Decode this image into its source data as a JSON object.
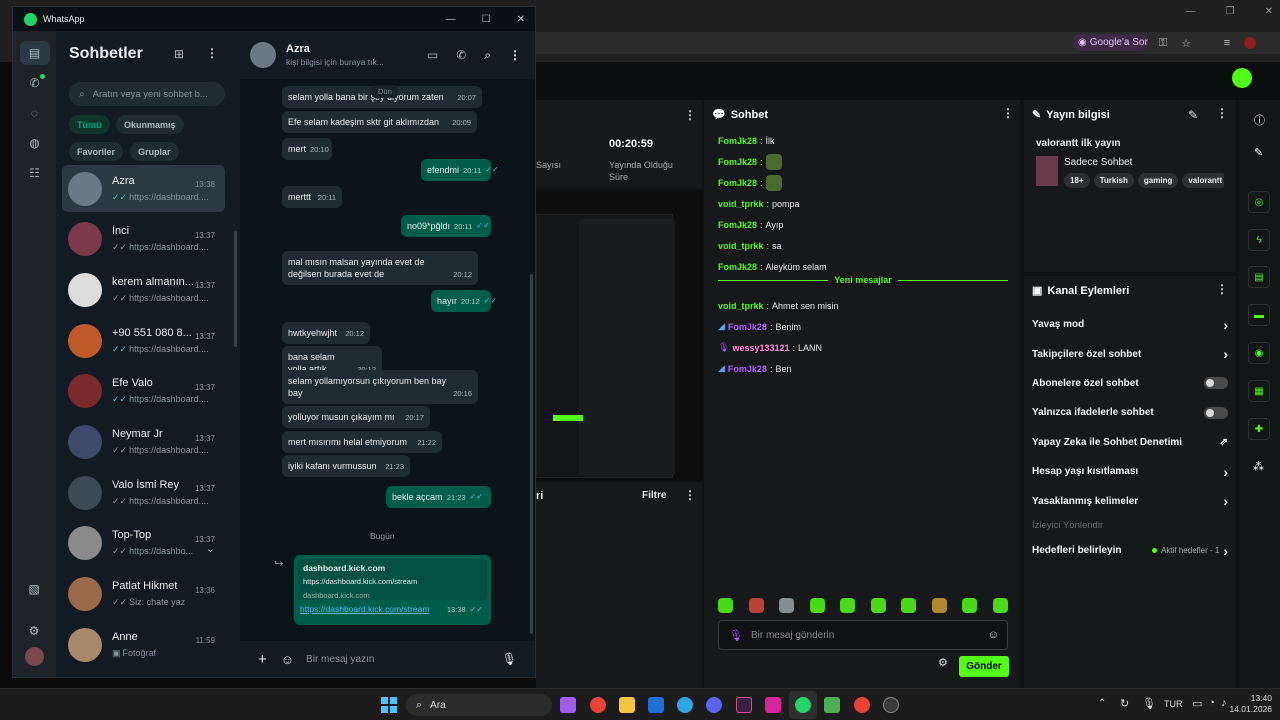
{
  "browser": {
    "google_sor": "Google'a Sor",
    "icons": [
      "lens-icon",
      "key-icon",
      "star-icon",
      "menu-icon",
      "profile-icon"
    ]
  },
  "whatsapp": {
    "title": "WhatsApp",
    "sidebar_title": "Sohbetler",
    "search_placeholder": "Aratın veya yeni sohbet b...",
    "filters": [
      "Tümü",
      "Okunmamış",
      "Favoriler",
      "Gruplar"
    ],
    "chats": [
      {
        "name": "Azra",
        "time": "13:38",
        "preview": "https://dashboard....",
        "tick": "blue",
        "color": "#6b7a86"
      },
      {
        "name": "İnci",
        "time": "13:37",
        "preview": "https://dashboard....",
        "tick": "grey",
        "color": "#7a3a4a"
      },
      {
        "name": "kerem almanın...",
        "time": "13:37",
        "preview": "https://dashboard....",
        "tick": "grey",
        "color": "#dcdcdc"
      },
      {
        "name": "+90 551 080 8...",
        "time": "13:37",
        "preview": "https://dashboard....",
        "tick": "blue",
        "color": "#c05a2a"
      },
      {
        "name": "Efe Valo",
        "time": "13:37",
        "preview": "https://dashboard....",
        "tick": "blue",
        "color": "#7a2a2a"
      },
      {
        "name": "Neymar Jr",
        "time": "13:37",
        "preview": "https://dashboard....",
        "tick": "grey",
        "color": "#3d4a6b"
      },
      {
        "name": "Valo İsmi Rey",
        "time": "13:37",
        "preview": "https://dashboard....",
        "tick": "grey",
        "color": "#3b4a54"
      },
      {
        "name": "Top-Top",
        "time": "13:37",
        "preview": "https://dashbo...",
        "tick": "grey",
        "color": "#8a8a8a"
      },
      {
        "name": "Patlat Hikmet",
        "time": "13:36",
        "preview": "Siz: chate yaz",
        "tick": "grey",
        "color": "#9a6a4a"
      },
      {
        "name": "Anne",
        "time": "11:59",
        "preview": "Fotoğraf",
        "tick": "none",
        "color": "#a88a6a"
      }
    ],
    "conversation": {
      "name": "Azra",
      "subtitle": "kişi bilgisi için buraya tık...",
      "date_chip_top": "Dün",
      "date_chip_today": "Bugün",
      "messages": [
        {
          "dir": "in",
          "text": "selam yolla bana bir şey diyorum zaten",
          "time": "20:07"
        },
        {
          "dir": "in",
          "text": "Efe selam kadeşim sktr git aklımızdan",
          "time": "20:09"
        },
        {
          "dir": "in",
          "text": "mert",
          "time": "20:10"
        },
        {
          "dir": "out",
          "text": "efendmi",
          "time": "20:11"
        },
        {
          "dir": "in",
          "text": "merttt",
          "time": "20:11"
        },
        {
          "dir": "out",
          "text": "no09*pğldı",
          "time": "20:11"
        },
        {
          "dir": "in",
          "text": "mal mısın malsan yayında evet de değilsen burada evet de",
          "time": "20:12"
        },
        {
          "dir": "out",
          "text": "hayır",
          "time": "20:12"
        },
        {
          "dir": "in",
          "text": "hwtkyehwjht",
          "time": "20:12"
        },
        {
          "dir": "in",
          "text": "bana selam yolla artık",
          "time": "20:12"
        },
        {
          "dir": "in",
          "text": "selam yollamıyorsun çıkıyorum ben bay bay",
          "time": "20:16"
        },
        {
          "dir": "in",
          "text": "yolluyor musun çıkayım mı",
          "time": "20:17"
        },
        {
          "dir": "in",
          "text": "mert mısırımı helal etmiyorum",
          "time": "21:22"
        },
        {
          "dir": "in",
          "text": "iyiki kafanı vurmussun",
          "time": "21:23"
        },
        {
          "dir": "out",
          "text": "bekle açcam",
          "time": "21:23"
        }
      ],
      "link_preview": {
        "title": "dashboard.kick.com",
        "url": "https://dashboard.kick.com/stream",
        "domain": "dashboard.kick.com",
        "link": "https://dashboard.kick.com/stream",
        "time": "13:38"
      },
      "composer_placeholder": "Bir mesaj yazın"
    }
  },
  "kick": {
    "stats": {
      "time": "00:20:59",
      "time_label": "Yayında Olduğu Süre",
      "partial_label": "Sayısı"
    },
    "chat": {
      "title": "Sohbet",
      "messages": [
        {
          "user": "FomJk28",
          "text": "İlk",
          "color": "#53fc18",
          "emote": false
        },
        {
          "user": "FomJk28",
          "text": "",
          "color": "#53fc18",
          "emote": true
        },
        {
          "user": "FomJk28",
          "text": "",
          "color": "#53fc18",
          "emote": true
        },
        {
          "user": "void_tprkk",
          "text": "pompa",
          "color": "#53fc18",
          "emote": false
        },
        {
          "user": "FomJk28",
          "text": "Ayıp",
          "color": "#53fc18",
          "emote": false
        },
        {
          "user": "void_tprkk",
          "text": "sa",
          "color": "#53fc18",
          "emote": false
        },
        {
          "user": "FomJk28",
          "text": "Aleyküm selam",
          "color": "#53fc18",
          "emote": false
        }
      ],
      "new_messages_label": "Yeni mesajlar",
      "new_messages": [
        {
          "user": "void_tprkk",
          "text": "Ahmet sen misin",
          "color": "#53fc18",
          "badge": ""
        },
        {
          "user": "FomJk28",
          "text": "Benim",
          "color": "#b05cff",
          "badge": "kick"
        },
        {
          "user": "wessy133121",
          "text": "LANN",
          "color": "#ff8ad8",
          "badge": "mic"
        },
        {
          "user": "FomJk28",
          "text": "Ben",
          "color": "#b05cff",
          "badge": "kick"
        }
      ],
      "input_placeholder": "Bir mesaj gönderin",
      "send_label": "Gönder"
    },
    "bottom_panel": {
      "partial_title": "ri",
      "filter_label": "Filtre"
    },
    "stream_info": {
      "title": "Yayın bilgisi",
      "stream_title": "valorantt ilk yayın",
      "category": "Sadece Sohbet",
      "tags": [
        "18+",
        "Turkish",
        "gaming",
        "valorantt"
      ]
    },
    "channel_actions": {
      "title": "Kanal Eylemleri",
      "items": [
        {
          "label": "Yavaş mod",
          "control": "chevron"
        },
        {
          "label": "Takipçilere özel sohbet",
          "control": "chevron"
        },
        {
          "label": "Abonelere özel sohbet",
          "control": "toggle"
        },
        {
          "label": "Yalnızca ifadelerle sohbet",
          "control": "toggle"
        },
        {
          "label": "Yapay Zeka ile Sohbet Denetimi",
          "control": "external"
        },
        {
          "label": "Hesap yaşı kısıtlaması",
          "control": "chevron"
        },
        {
          "label": "Yasaklanmış kelimeler",
          "control": "chevron"
        }
      ],
      "section_label": "İzleyici Yönlendir",
      "goals_label": "Hedefleri belirleyin",
      "goals_status": "Aktif hedefler - 1"
    }
  },
  "taskbar": {
    "search": "Ara",
    "lang": "TUR",
    "time": "13:40",
    "date": "14.01.2026"
  }
}
